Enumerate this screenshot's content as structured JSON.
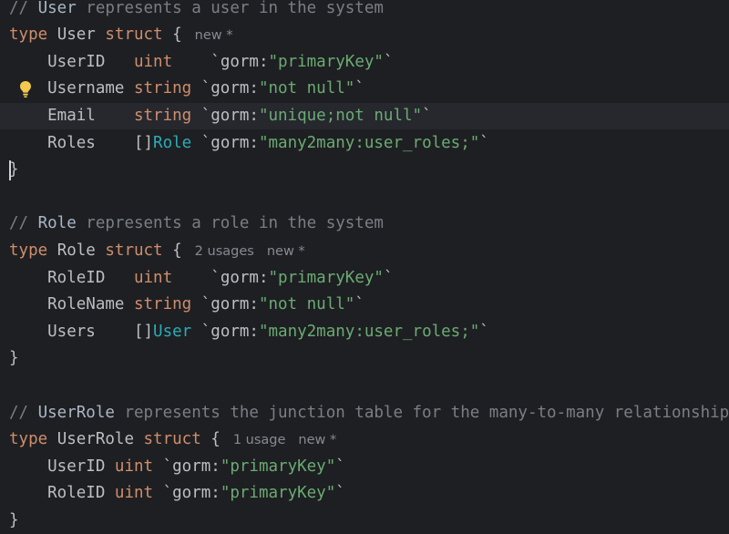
{
  "editor": {
    "lines": [
      {
        "parts": [
          {
            "c": "c-comment",
            "t": "// "
          },
          {
            "c": "c-ident",
            "t": "User"
          },
          {
            "c": "c-comment",
            "t": " represents a user in the system"
          }
        ]
      },
      {
        "parts": [
          {
            "c": "c-kw",
            "t": "type"
          },
          {
            "c": "c-name",
            "t": " User "
          },
          {
            "c": "c-kw",
            "t": "struct"
          },
          {
            "c": "c-punct",
            "t": " {"
          }
        ],
        "hints": [
          "new *"
        ]
      },
      {
        "parts": [
          {
            "c": "c-name",
            "t": "    UserID   "
          },
          {
            "c": "c-type",
            "t": "uint"
          },
          {
            "c": "c-punct",
            "t": "    `"
          },
          {
            "c": "c-tag",
            "t": "gorm:"
          },
          {
            "c": "c-str",
            "t": "\"primaryKey\""
          },
          {
            "c": "c-punct",
            "t": "`"
          }
        ]
      },
      {
        "parts": [
          {
            "c": "c-name",
            "t": "    Username "
          },
          {
            "c": "c-type",
            "t": "string"
          },
          {
            "c": "c-punct",
            "t": " `"
          },
          {
            "c": "c-tag",
            "t": "gorm:"
          },
          {
            "c": "c-str",
            "t": "\"not null\""
          },
          {
            "c": "c-punct",
            "t": "`"
          }
        ],
        "bulb": true
      },
      {
        "parts": [
          {
            "c": "c-name",
            "t": "    Email    "
          },
          {
            "c": "c-type",
            "t": "string"
          },
          {
            "c": "c-punct",
            "t": " `"
          },
          {
            "c": "c-tag",
            "t": "gorm:"
          },
          {
            "c": "c-str",
            "t": "\"unique;not null\""
          },
          {
            "c": "c-punct",
            "t": "`"
          }
        ],
        "current": true
      },
      {
        "parts": [
          {
            "c": "c-name",
            "t": "    Roles    "
          },
          {
            "c": "c-punct",
            "t": "[]"
          },
          {
            "c": "c-typeref-alt",
            "t": "Role"
          },
          {
            "c": "c-punct",
            "t": " `"
          },
          {
            "c": "c-tag",
            "t": "gorm:"
          },
          {
            "c": "c-str",
            "t": "\"many2many:user_roles;\""
          },
          {
            "c": "c-punct",
            "t": "`"
          }
        ]
      },
      {
        "parts": [
          {
            "c": "c-punct",
            "t": "}"
          }
        ],
        "caret": true
      },
      {
        "parts": []
      },
      {
        "parts": [
          {
            "c": "c-comment",
            "t": "// "
          },
          {
            "c": "c-ident",
            "t": "Role"
          },
          {
            "c": "c-comment",
            "t": " represents a role in the system"
          }
        ]
      },
      {
        "parts": [
          {
            "c": "c-kw",
            "t": "type"
          },
          {
            "c": "c-name",
            "t": " Role "
          },
          {
            "c": "c-kw",
            "t": "struct"
          },
          {
            "c": "c-punct",
            "t": " {"
          }
        ],
        "hints": [
          "2 usages",
          "new *"
        ]
      },
      {
        "parts": [
          {
            "c": "c-name",
            "t": "    RoleID   "
          },
          {
            "c": "c-type",
            "t": "uint"
          },
          {
            "c": "c-punct",
            "t": "    `"
          },
          {
            "c": "c-tag",
            "t": "gorm:"
          },
          {
            "c": "c-str",
            "t": "\"primaryKey\""
          },
          {
            "c": "c-punct",
            "t": "`"
          }
        ]
      },
      {
        "parts": [
          {
            "c": "c-name",
            "t": "    RoleName "
          },
          {
            "c": "c-type",
            "t": "string"
          },
          {
            "c": "c-punct",
            "t": " `"
          },
          {
            "c": "c-tag",
            "t": "gorm:"
          },
          {
            "c": "c-str",
            "t": "\"not null\""
          },
          {
            "c": "c-punct",
            "t": "`"
          }
        ]
      },
      {
        "parts": [
          {
            "c": "c-name",
            "t": "    Users    "
          },
          {
            "c": "c-punct",
            "t": "[]"
          },
          {
            "c": "c-typeref-alt",
            "t": "User"
          },
          {
            "c": "c-punct",
            "t": " `"
          },
          {
            "c": "c-tag",
            "t": "gorm:"
          },
          {
            "c": "c-str",
            "t": "\"many2many:user_roles;\""
          },
          {
            "c": "c-punct",
            "t": "`"
          }
        ]
      },
      {
        "parts": [
          {
            "c": "c-punct",
            "t": "}"
          }
        ]
      },
      {
        "parts": []
      },
      {
        "parts": [
          {
            "c": "c-comment",
            "t": "// "
          },
          {
            "c": "c-ident",
            "t": "UserRole"
          },
          {
            "c": "c-comment",
            "t": " represents the junction table for the many-to-many relationship"
          }
        ]
      },
      {
        "parts": [
          {
            "c": "c-kw",
            "t": "type"
          },
          {
            "c": "c-name",
            "t": " UserRole "
          },
          {
            "c": "c-kw",
            "t": "struct"
          },
          {
            "c": "c-punct",
            "t": " {"
          }
        ],
        "hints": [
          "1 usage",
          "new *"
        ]
      },
      {
        "parts": [
          {
            "c": "c-name",
            "t": "    UserID "
          },
          {
            "c": "c-type",
            "t": "uint"
          },
          {
            "c": "c-punct",
            "t": " `"
          },
          {
            "c": "c-tag",
            "t": "gorm:"
          },
          {
            "c": "c-str",
            "t": "\"primaryKey\""
          },
          {
            "c": "c-punct",
            "t": "`"
          }
        ]
      },
      {
        "parts": [
          {
            "c": "c-name",
            "t": "    RoleID "
          },
          {
            "c": "c-type",
            "t": "uint"
          },
          {
            "c": "c-punct",
            "t": " `"
          },
          {
            "c": "c-tag",
            "t": "gorm:"
          },
          {
            "c": "c-str",
            "t": "\"primaryKey\""
          },
          {
            "c": "c-punct",
            "t": "`"
          }
        ]
      },
      {
        "parts": [
          {
            "c": "c-punct",
            "t": "}"
          }
        ]
      }
    ]
  },
  "colors": {
    "background": "#1e1f22",
    "keyword": "#cf8e6d",
    "string": "#6aab73",
    "comment": "#7a7e85",
    "type_ref": "#2aacb8",
    "bulb": "#f2c94c"
  },
  "icons": {
    "intention_bulb": "lightbulb-icon"
  }
}
